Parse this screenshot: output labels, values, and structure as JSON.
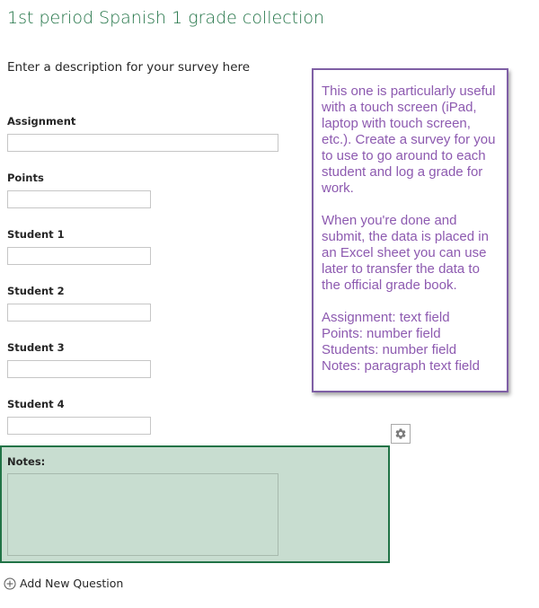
{
  "survey": {
    "title": "1st period Spanish 1 grade collection",
    "description": "Enter a description for your survey here"
  },
  "questions": [
    {
      "label": "Assignment"
    },
    {
      "label": "Points"
    },
    {
      "label": "Student 1"
    },
    {
      "label": "Student 2"
    },
    {
      "label": "Student 3"
    },
    {
      "label": "Student 4"
    }
  ],
  "notes": {
    "label": "Notes:"
  },
  "toolbar": {
    "settings_icon": "gear-icon"
  },
  "add_question": {
    "icon": "plus-circle-icon",
    "label": "Add New Question"
  },
  "callout": {
    "paragraph1": "This one is particularly useful with a touch screen (iPad, laptop with touch screen, etc.). Create a survey for you to use to go around to each student and log a grade for work.",
    "paragraph2": "When you're done and submit, the data is placed in an Excel sheet you can use later to transfer the data to the official grade book.",
    "line1": "Assignment: text field",
    "line2": "Points: number field",
    "line3": "Students: number field",
    "line4": "Notes: paragraph text field"
  },
  "colors": {
    "accent": "#217346",
    "selected_bg": "#c8ddd0",
    "callout_text": "#8d5ab0",
    "callout_border": "#7f5fa5"
  }
}
